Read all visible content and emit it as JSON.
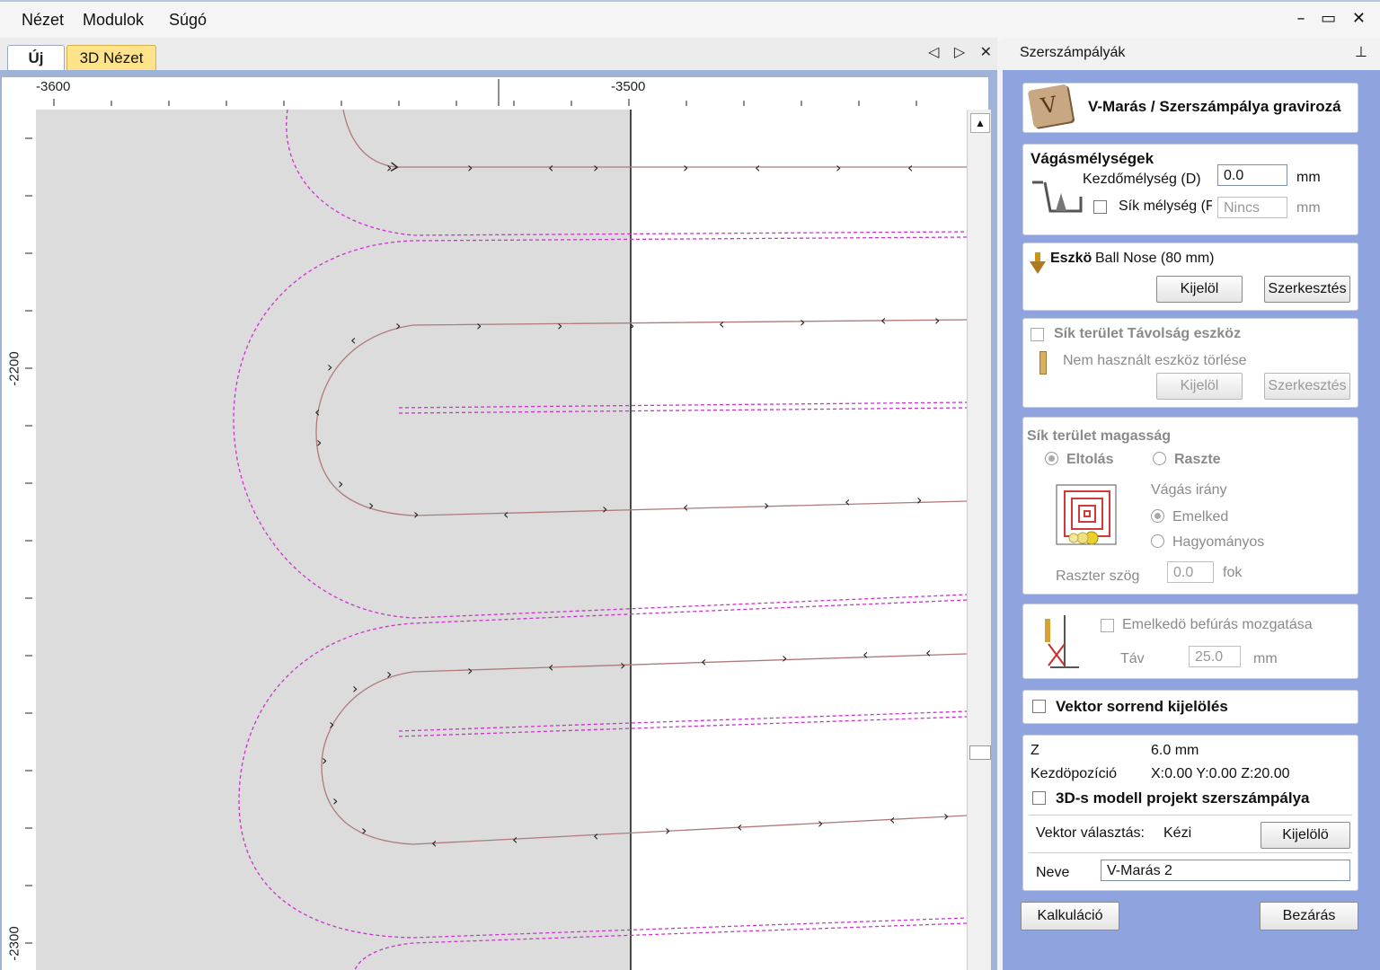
{
  "menu": {
    "items": [
      "Nézet",
      "Modulok",
      "Súgó"
    ]
  },
  "window_controls": "– ▭ ✕",
  "tabs": {
    "new": "Új",
    "view3d": "3D Nézet"
  },
  "tab_controls": "◁ ▷ ✕",
  "ruler": {
    "top_labels": [
      "-3600",
      "-3500"
    ],
    "left_labels": [
      "-2200",
      "-2300"
    ]
  },
  "panel": {
    "title": "Szerszámpályák",
    "pin": "⊥",
    "header": "V-Marás / Szerszámpálya gravirozá",
    "depths": {
      "title": "Vágásmélységek",
      "start_label": "Kezdőmélység (D)",
      "start_value": "0.0",
      "start_unit": "mm",
      "flat_label": "Sík mélység (F",
      "flat_placeholder": "Nincs",
      "flat_unit": "mm"
    },
    "tool": {
      "label": "Eszkö",
      "name": "Ball Nose (80 mm)",
      "select": "Kijelöl",
      "edit": "Szerkesztés"
    },
    "flat_area_tool": {
      "title": "Sík terület Távolság eszköz",
      "subtitle": "Nem használt eszköz törlése",
      "select": "Kijelöl",
      "edit": "Szerkesztés"
    },
    "flat_area_height": {
      "title": "Sík terület magasság",
      "offset": "Eltolás",
      "raster": "Raszte",
      "cut_dir": "Vágás irány",
      "climb": "Emelked",
      "conventional": "Hagyományos",
      "raster_angle_label": "Raszter szög",
      "raster_angle_value": "0.0",
      "raster_angle_unit": "fok"
    },
    "ramp": {
      "label": "Emelkedö befúrás mozgatása",
      "dist_label": "Táv",
      "dist_value": "25.0",
      "dist_unit": "mm"
    },
    "vector_order": "Vektor sorrend kijelölés",
    "info": {
      "z_label": "Z",
      "z_value": "6.0 mm",
      "home_label": "Kezdöpozíció",
      "home_value": "X:0.00 Y:0.00 Z:20.00",
      "model_project": "3D-s modell projekt szerszámpálya",
      "vector_sel_label": "Vektor választás:",
      "vector_sel_value": "Kézi",
      "vector_sel_button": "Kijelölö",
      "name_label": "Neve",
      "name_value": "V-Marás 2"
    },
    "calc": "Kalkuláció",
    "close": "Bezárás"
  },
  "colors": {
    "boundary": "#cc33cc",
    "toolpath": "#b07a7a",
    "shade": "#dcdcdc",
    "panel_bg": "#8fa3de"
  }
}
